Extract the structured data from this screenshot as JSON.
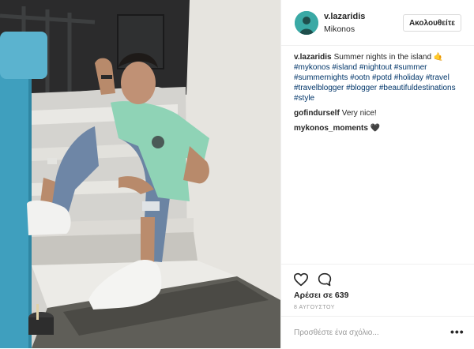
{
  "post": {
    "username": "v.lazaridis",
    "location": "Mikonos",
    "follow_label": "Ακολουθείτε",
    "caption": {
      "username": "v.lazaridis",
      "text": "Summer nights in the island ",
      "emoji": "🤙",
      "hashtags": [
        "#mykonos",
        "#island",
        "#nightout",
        "#summer",
        "#summernights",
        "#ootn",
        "#potd",
        "#holiday",
        "#travel",
        "#travelblogger",
        "#blogger",
        "#beautifuldestinations",
        "#style"
      ]
    },
    "comments": [
      {
        "username": "gofindurself",
        "text": "Very nice!"
      },
      {
        "username": "mykonos_moments",
        "text": "🖤"
      }
    ],
    "likes_text": "Αρέσει σε 639",
    "date_text": "8 ΑΥΓΟΥΣΤΟΥ",
    "add_comment_placeholder": "Προσθέστε ένα σχόλιο...",
    "more_icon": "•••"
  },
  "colors": {
    "text": "#262626",
    "hashtag": "#003569",
    "muted": "#999999",
    "border": "#efefef",
    "shirt": "#8fd3b6",
    "wall_blue": "#3f9fbe"
  }
}
